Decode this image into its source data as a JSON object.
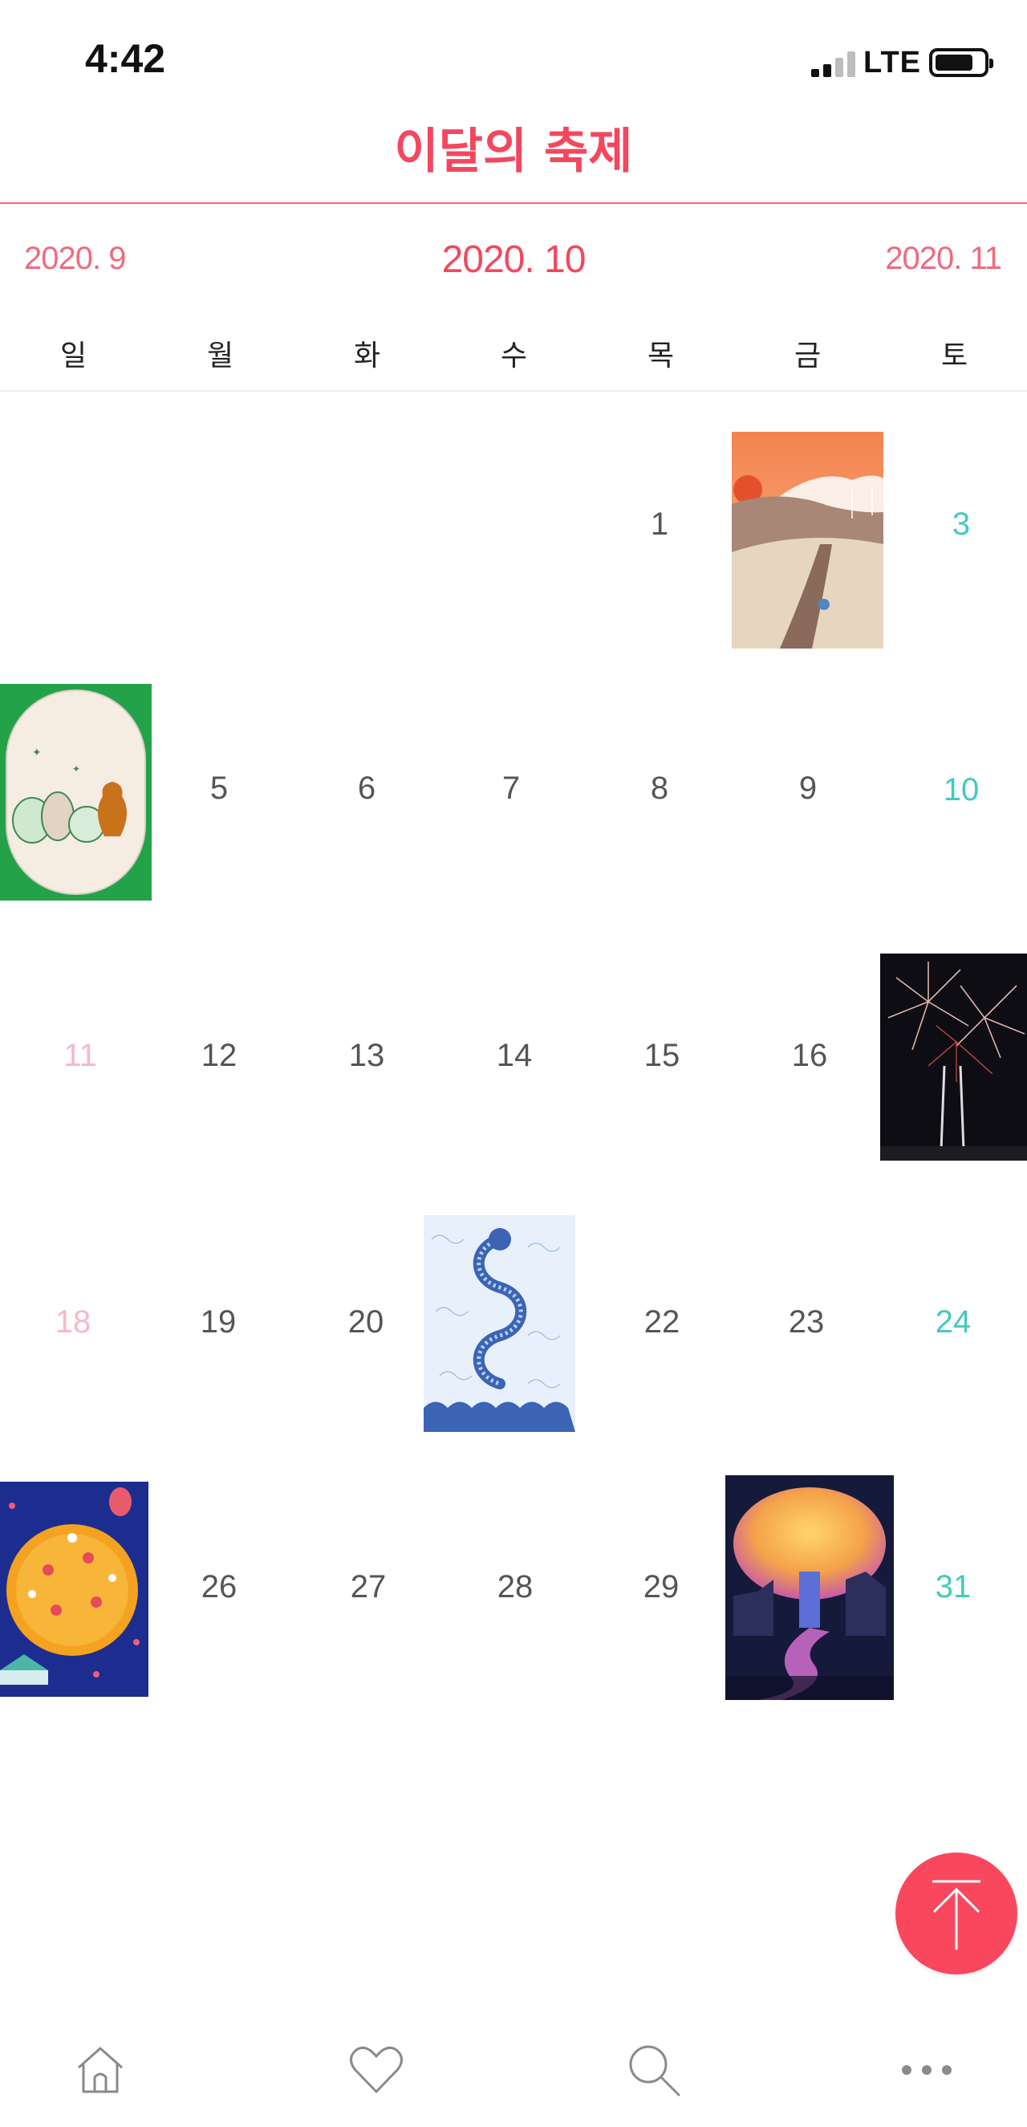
{
  "status_bar": {
    "time": "4:42",
    "network": "LTE"
  },
  "page_title": "이달의 축제",
  "month_nav": {
    "prev": "2020. 9",
    "current": "2020. 10",
    "next": "2020. 11"
  },
  "weekdays": [
    "일",
    "월",
    "화",
    "수",
    "목",
    "금",
    "토"
  ],
  "calendar": {
    "weeks": [
      [
        "",
        "",
        "",
        "",
        "1",
        "",
        "3"
      ],
      [
        "",
        "5",
        "6",
        "7",
        "8",
        "9",
        "10"
      ],
      [
        "11",
        "12",
        "13",
        "14",
        "15",
        "16",
        ""
      ],
      [
        "18",
        "19",
        "20",
        "",
        "22",
        "23",
        "24"
      ],
      [
        "",
        "26",
        "27",
        "28",
        "29",
        "",
        "31"
      ]
    ],
    "festival_posters": [
      {
        "day": 2,
        "icon": "sunset-flower-field-poster"
      },
      {
        "day": 4,
        "icon": "pottery-jars-poster"
      },
      {
        "day": 17,
        "icon": "fireworks-poster"
      },
      {
        "day": 21,
        "icon": "blue-dragon-poster"
      },
      {
        "day": 25,
        "icon": "circus-festival-poster"
      },
      {
        "day": 30,
        "icon": "light-tree-poster"
      }
    ]
  },
  "colors": {
    "accent": "#f2485f",
    "saturday": "#45c9be",
    "sunday": "#f7b8c8",
    "fab": "#f9475e"
  },
  "bottom_nav": [
    "home-icon",
    "heart-icon",
    "search-icon",
    "more-icon"
  ]
}
